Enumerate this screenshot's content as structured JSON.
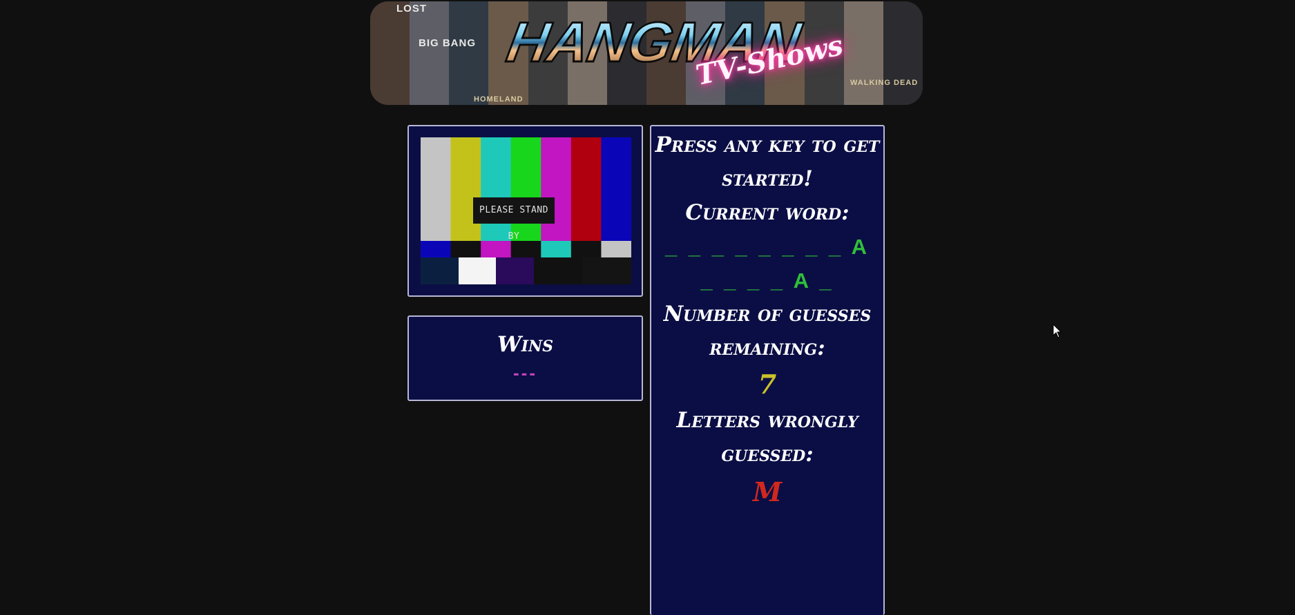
{
  "banner": {
    "title": "HANGMAN",
    "subtitle": "TV-Shows",
    "poster_labels": [
      "LOST",
      "BIG BANG",
      "HOMELAND",
      "WALKING DEAD"
    ]
  },
  "tv": {
    "standby_text": "PLEASE STAND BY",
    "bar_colors": [
      "#c4c4c4",
      "#c2c21a",
      "#1ec9b9",
      "#18d61b",
      "#c116c1",
      "#b0000f",
      "#0a06b8"
    ]
  },
  "wins": {
    "title": "Wins",
    "value": "---"
  },
  "game": {
    "prompt": "Press any key to get started!",
    "current_word_label": "Current word:",
    "current_word": "_ _ _ _ _ _ _ _ A _ _ _ _ A _",
    "guesses_label": "Number of guesses remaining:",
    "guesses_remaining": "7",
    "wrong_label": "Letters wrongly guessed:",
    "wrong_letters": "M"
  },
  "colors": {
    "page_bg": "#101010",
    "panel_bg": "#0b0e44",
    "panel_border": "#b8b8d8",
    "word_color": "#2fbf3a",
    "guesses_color": "#c9c22a",
    "wrong_color": "#d0281e",
    "wins_color": "#c542c0"
  }
}
